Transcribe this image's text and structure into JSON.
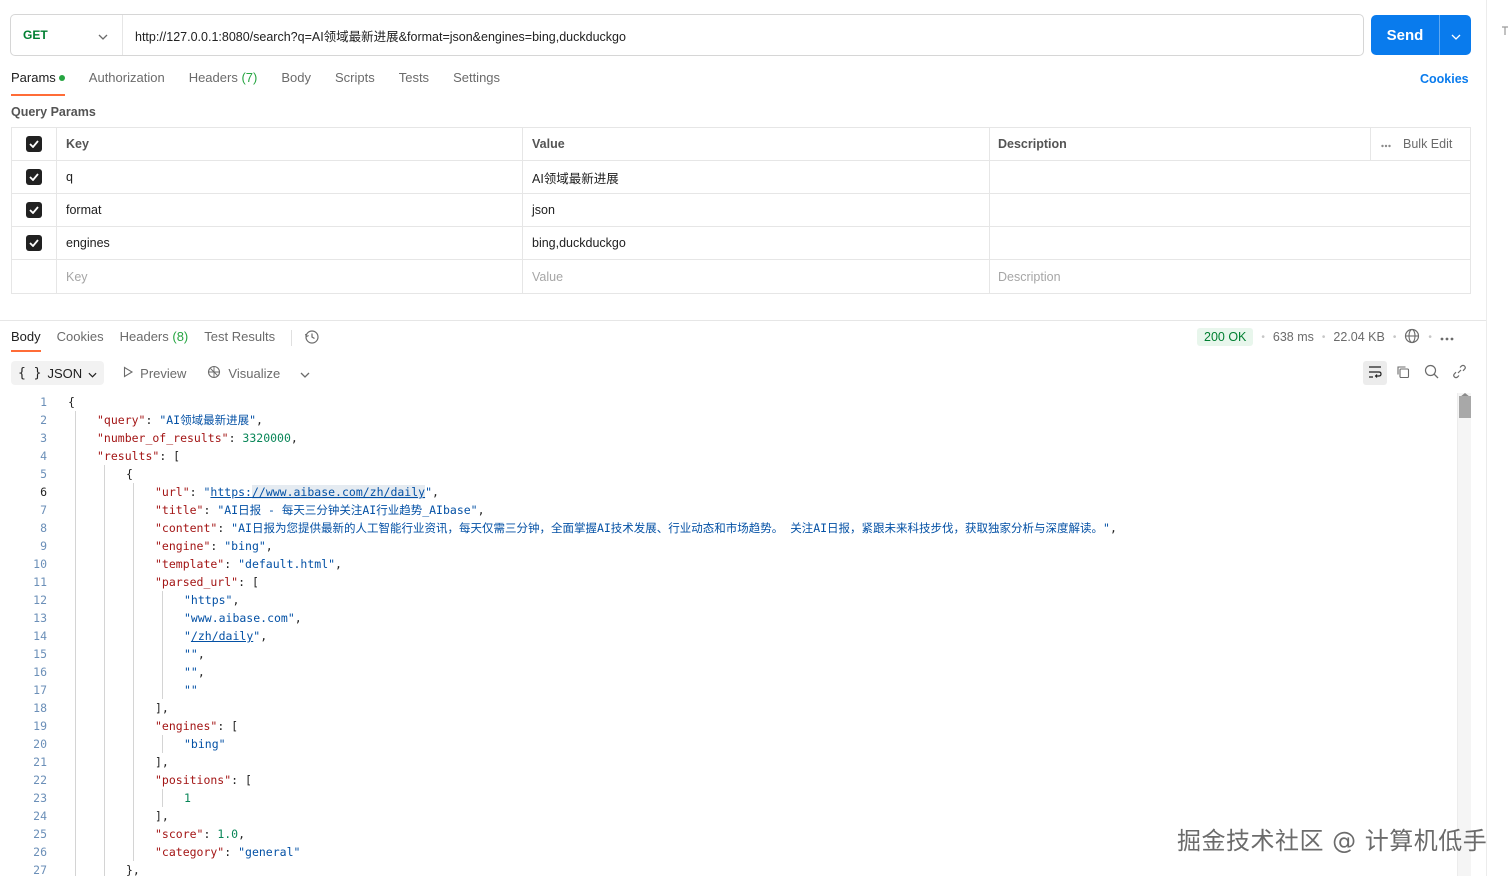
{
  "request": {
    "method": "GET",
    "url": "http://127.0.0.1:8080/search?q=AI领域最新进展&format=json&engines=bing,duckduckgo",
    "send_label": "Send"
  },
  "request_tabs": {
    "params": "Params",
    "authorization": "Authorization",
    "headers": "Headers",
    "headers_count": "(7)",
    "body": "Body",
    "scripts": "Scripts",
    "tests": "Tests",
    "settings": "Settings",
    "cookies": "Cookies"
  },
  "query_params": {
    "title": "Query Params",
    "headers": {
      "key": "Key",
      "value": "Value",
      "description": "Description",
      "bulk_edit": "Bulk Edit"
    },
    "rows": [
      {
        "key": "q",
        "value": "AI领域最新进展",
        "description": ""
      },
      {
        "key": "format",
        "value": "json",
        "description": ""
      },
      {
        "key": "engines",
        "value": "bing,duckduckgo",
        "description": ""
      }
    ],
    "placeholders": {
      "key": "Key",
      "value": "Value",
      "description": "Description"
    }
  },
  "response_tabs": {
    "body": "Body",
    "cookies": "Cookies",
    "headers": "Headers",
    "headers_count": "(8)",
    "test_results": "Test Results"
  },
  "response_status": {
    "code": "200 OK",
    "time": "638 ms",
    "size": "22.04 KB"
  },
  "body_toolbar": {
    "format": "JSON",
    "preview": "Preview",
    "visualize": "Visualize"
  },
  "code": {
    "current_line": 6,
    "lines": [
      {
        "n": "1",
        "indent": 0,
        "parts": [
          [
            "p",
            "{"
          ]
        ]
      },
      {
        "n": "2",
        "indent": 1,
        "parts": [
          [
            "k",
            "\"query\""
          ],
          [
            "p",
            ": "
          ],
          [
            "s",
            "\"AI领域最新进展\""
          ],
          [
            "p",
            ","
          ]
        ]
      },
      {
        "n": "3",
        "indent": 1,
        "parts": [
          [
            "k",
            "\"number_of_results\""
          ],
          [
            "p",
            ": "
          ],
          [
            "n",
            "3320000"
          ],
          [
            "p",
            ","
          ]
        ]
      },
      {
        "n": "4",
        "indent": 1,
        "parts": [
          [
            "k",
            "\"results\""
          ],
          [
            "p",
            ": ["
          ]
        ]
      },
      {
        "n": "5",
        "indent": 2,
        "parts": [
          [
            "p",
            "{"
          ]
        ]
      },
      {
        "n": "6",
        "indent": 3,
        "parts": [
          [
            "k",
            "\"url\""
          ],
          [
            "p",
            ": "
          ],
          [
            "s",
            "\""
          ],
          [
            "su",
            "https:"
          ],
          [
            "suh",
            "//www.aibase.com/zh/daily"
          ],
          [
            "s",
            "\""
          ],
          [
            "p",
            ","
          ]
        ]
      },
      {
        "n": "7",
        "indent": 3,
        "parts": [
          [
            "k",
            "\"title\""
          ],
          [
            "p",
            ": "
          ],
          [
            "s",
            "\"AI日报 - 每天三分钟关注AI行业趋势_AIbase\""
          ],
          [
            "p",
            ","
          ]
        ]
      },
      {
        "n": "8",
        "indent": 3,
        "parts": [
          [
            "k",
            "\"content\""
          ],
          [
            "p",
            ": "
          ],
          [
            "s",
            "\"AI日报为您提供最新的人工智能行业资讯，每天仅需三分钟，全面掌握AI技术发展、行业动态和市场趋势。 关注AI日报，紧跟未来科技步伐，获取独家分析与深度解读。\""
          ],
          [
            "p",
            ","
          ]
        ]
      },
      {
        "n": "9",
        "indent": 3,
        "parts": [
          [
            "k",
            "\"engine\""
          ],
          [
            "p",
            ": "
          ],
          [
            "s",
            "\"bing\""
          ],
          [
            "p",
            ","
          ]
        ]
      },
      {
        "n": "10",
        "indent": 3,
        "parts": [
          [
            "k",
            "\"template\""
          ],
          [
            "p",
            ": "
          ],
          [
            "s",
            "\"default.html\""
          ],
          [
            "p",
            ","
          ]
        ]
      },
      {
        "n": "11",
        "indent": 3,
        "parts": [
          [
            "k",
            "\"parsed_url\""
          ],
          [
            "p",
            ": ["
          ]
        ]
      },
      {
        "n": "12",
        "indent": 4,
        "parts": [
          [
            "s",
            "\"https\""
          ],
          [
            "p",
            ","
          ]
        ]
      },
      {
        "n": "13",
        "indent": 4,
        "parts": [
          [
            "s",
            "\"www.aibase.com\""
          ],
          [
            "p",
            ","
          ]
        ]
      },
      {
        "n": "14",
        "indent": 4,
        "parts": [
          [
            "s",
            "\""
          ],
          [
            "su",
            "/zh/daily"
          ],
          [
            "s",
            "\""
          ],
          [
            "p",
            ","
          ]
        ]
      },
      {
        "n": "15",
        "indent": 4,
        "parts": [
          [
            "s",
            "\"\""
          ],
          [
            "p",
            ","
          ]
        ]
      },
      {
        "n": "16",
        "indent": 4,
        "parts": [
          [
            "s",
            "\"\""
          ],
          [
            "p",
            ","
          ]
        ]
      },
      {
        "n": "17",
        "indent": 4,
        "parts": [
          [
            "s",
            "\"\""
          ]
        ]
      },
      {
        "n": "18",
        "indent": 3,
        "parts": [
          [
            "p",
            "],"
          ]
        ]
      },
      {
        "n": "19",
        "indent": 3,
        "parts": [
          [
            "k",
            "\"engines\""
          ],
          [
            "p",
            ": ["
          ]
        ]
      },
      {
        "n": "20",
        "indent": 4,
        "parts": [
          [
            "s",
            "\"bing\""
          ]
        ]
      },
      {
        "n": "21",
        "indent": 3,
        "parts": [
          [
            "p",
            "],"
          ]
        ]
      },
      {
        "n": "22",
        "indent": 3,
        "parts": [
          [
            "k",
            "\"positions\""
          ],
          [
            "p",
            ": ["
          ]
        ]
      },
      {
        "n": "23",
        "indent": 4,
        "parts": [
          [
            "n",
            "1"
          ]
        ]
      },
      {
        "n": "24",
        "indent": 3,
        "parts": [
          [
            "p",
            "],"
          ]
        ]
      },
      {
        "n": "25",
        "indent": 3,
        "parts": [
          [
            "k",
            "\"score\""
          ],
          [
            "p",
            ": "
          ],
          [
            "n",
            "1.0"
          ],
          [
            "p",
            ","
          ]
        ]
      },
      {
        "n": "26",
        "indent": 3,
        "parts": [
          [
            "k",
            "\"category\""
          ],
          [
            "p",
            ": "
          ],
          [
            "s",
            "\"general\""
          ]
        ]
      },
      {
        "n": "27",
        "indent": 2,
        "parts": [
          [
            "p",
            "},"
          ]
        ]
      }
    ]
  },
  "watermark": "掘金技术社区 @ 计算机低手",
  "colors": {
    "accent": "#ff6c37",
    "send": "#097bed",
    "method": "#007f31",
    "status_ok": "#007f31"
  }
}
